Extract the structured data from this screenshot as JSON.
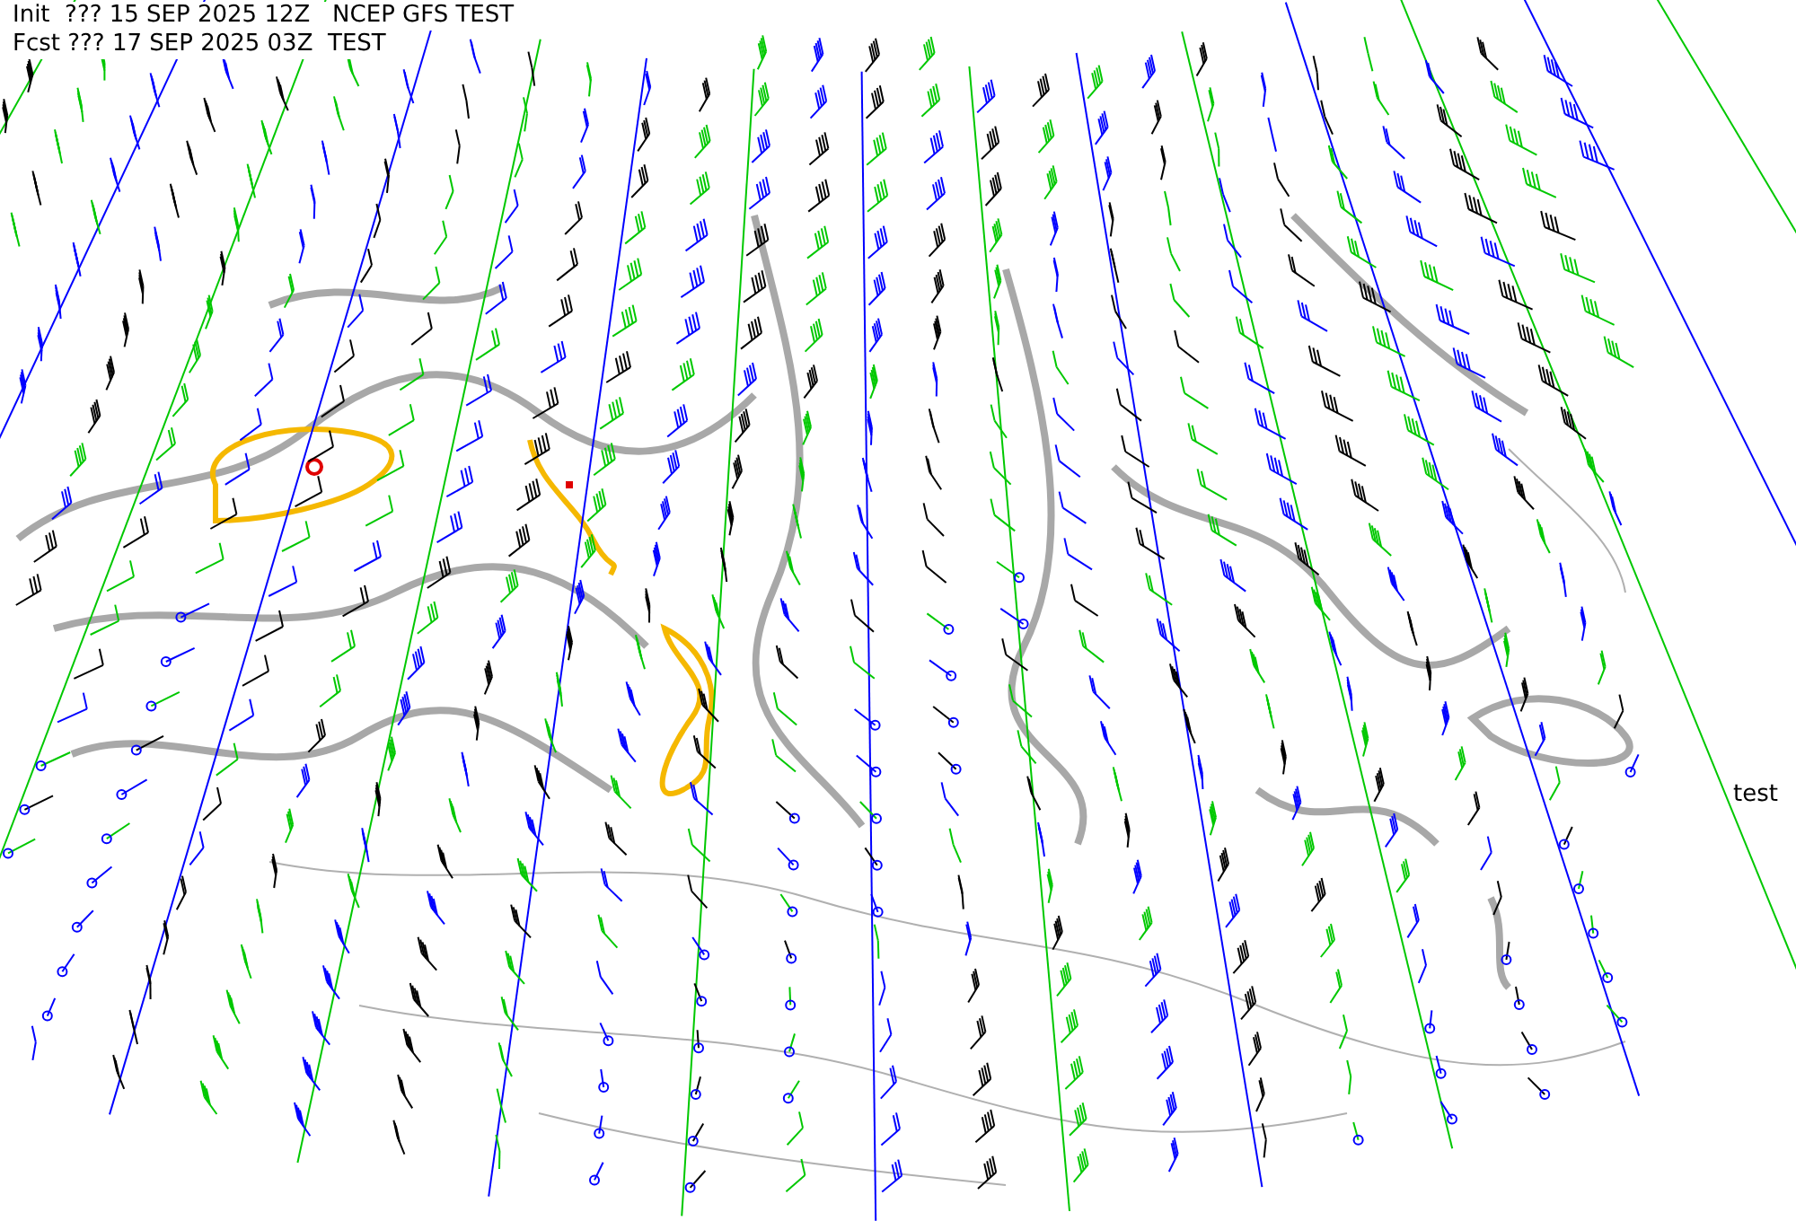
{
  "header": {
    "lines": [
      "Init  ??? 15 SEP 2025 12Z   NCEP GFS TEST",
      "Fcst ??? 17 SEP 2025 03Z  TEST"
    ]
  },
  "side_label": "test"
}
